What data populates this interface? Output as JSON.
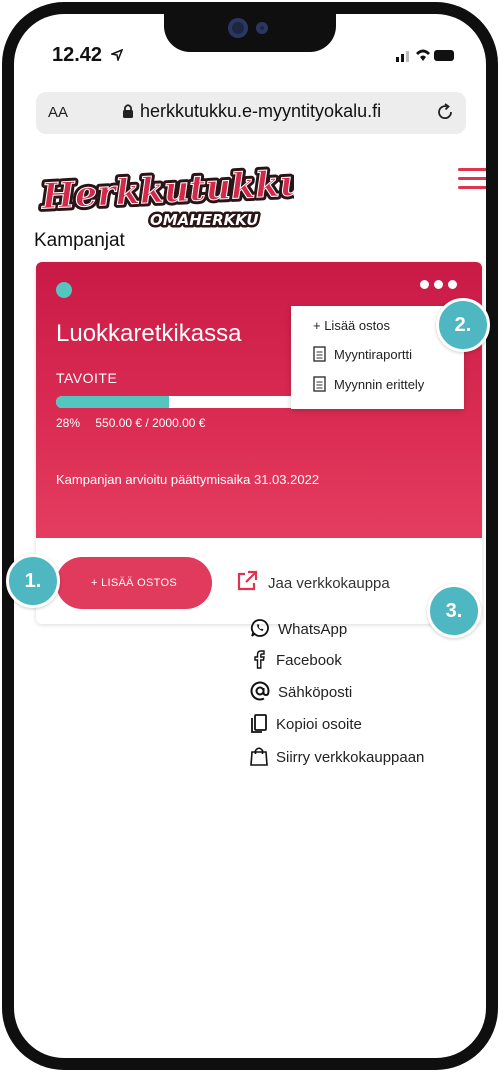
{
  "status_bar": {
    "time": "12.42"
  },
  "browser": {
    "text_size_label": "AA",
    "url": "herkkutukku.e-myyntityokalu.fi"
  },
  "brand": {
    "logo_main": "Herkkutukku",
    "logo_sub": "OMAHERKKU",
    "accent_color": "#e0334f"
  },
  "page": {
    "title": "Kampanjat"
  },
  "campaign": {
    "name": "Luokkaretkikassa",
    "goal_label": "TAVOITE",
    "progress_percent": 28,
    "progress_text": "28%",
    "amount_text": "550.00 € / 2000.00 €",
    "end_text": "Kampanjan arvioitu päättymisaika 31.03.2022",
    "add_button": "+ LISÄÄ OSTOS",
    "card_color": "#d42a50",
    "dot_color": "#55c6bf"
  },
  "actions_menu": {
    "add_purchase": "+ Lisää ostos",
    "sales_report": "Myyntiraportti",
    "sales_breakdown": "Myynnin erittely"
  },
  "share": {
    "heading": "Jaa verkkokauppa",
    "items": [
      {
        "label": "WhatsApp",
        "icon": "whatsapp-icon"
      },
      {
        "label": "Facebook",
        "icon": "facebook-icon"
      },
      {
        "label": "Sähköposti",
        "icon": "at-icon"
      },
      {
        "label": "Kopioi osoite",
        "icon": "copy-icon"
      },
      {
        "label": "Siirry verkkokauppaan",
        "icon": "shopping-bag-icon"
      }
    ]
  },
  "callouts": {
    "one": "1.",
    "two": "2.",
    "three": "3.",
    "color": "#4fb7c1"
  }
}
